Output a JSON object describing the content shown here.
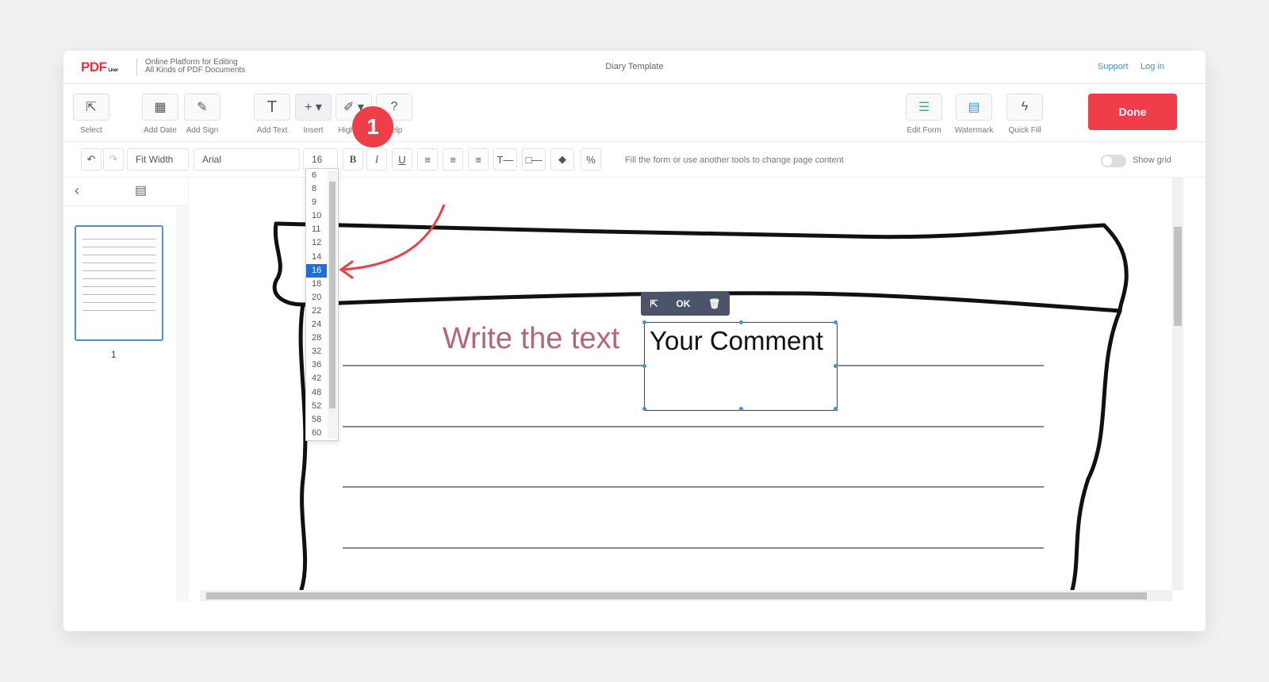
{
  "header": {
    "logo_text": "PDF",
    "logo_suffix": "Liner",
    "tagline_line1": "Online Platform for Editing",
    "tagline_line2": "All Kinds of PDF Documents",
    "doc_title": "Diary Template",
    "support_label": "Support",
    "login_label": "Log in"
  },
  "toolbar": {
    "select": "Select",
    "add_date": "Add Date",
    "add_sign": "Add Sign",
    "add_text": "Add Text",
    "insert": "Insert",
    "highlight": "Highlight",
    "help": "Help",
    "edit_form": "Edit Form",
    "watermark": "Watermark",
    "quick_fill": "Quick Fill",
    "done": "Done"
  },
  "format": {
    "zoom": "Fit Width",
    "font": "Arial",
    "size": "16",
    "hint": "Fill the form or use another tools to change page content",
    "show_grid": "Show grid"
  },
  "font_sizes": [
    "6",
    "8",
    "9",
    "10",
    "11",
    "12",
    "14",
    "16",
    "18",
    "20",
    "22",
    "24",
    "28",
    "32",
    "36",
    "42",
    "48",
    "52",
    "58",
    "60"
  ],
  "selected_size": "16",
  "sidebar": {
    "page_number": "1"
  },
  "document": {
    "field_placeholder": "Write the text",
    "comment_text": "Your Comment",
    "popup_ok": "OK"
  },
  "annotation": {
    "step": "1"
  }
}
